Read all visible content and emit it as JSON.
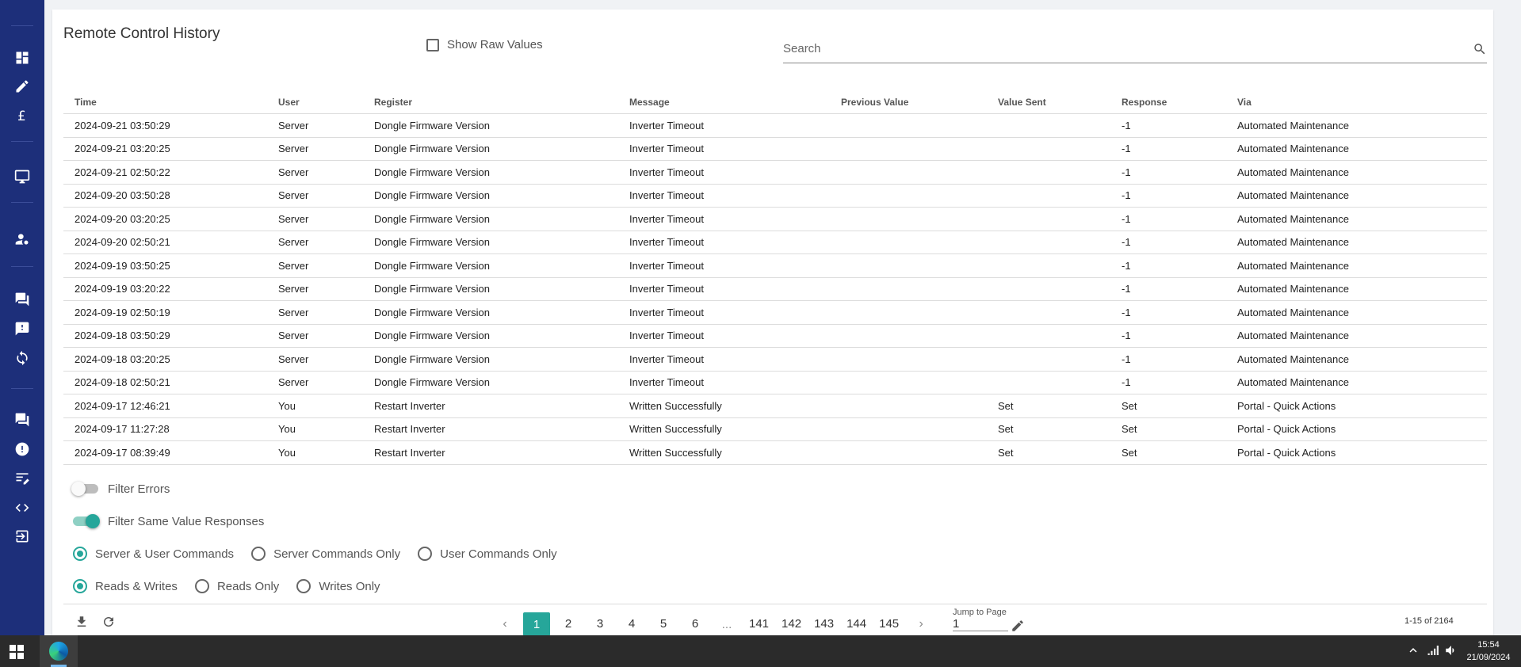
{
  "page": {
    "title": "Remote Control History"
  },
  "toolbar": {
    "show_raw_label": "Show Raw Values",
    "search_placeholder": "Search"
  },
  "table": {
    "columns": [
      "Time",
      "User",
      "Register",
      "Message",
      "Previous Value",
      "Value Sent",
      "Response",
      "Via"
    ],
    "rows": [
      [
        "2024-09-21 03:50:29",
        "Server",
        "Dongle Firmware Version",
        "Inverter Timeout",
        "",
        "",
        "-1",
        "Automated Maintenance"
      ],
      [
        "2024-09-21 03:20:25",
        "Server",
        "Dongle Firmware Version",
        "Inverter Timeout",
        "",
        "",
        "-1",
        "Automated Maintenance"
      ],
      [
        "2024-09-21 02:50:22",
        "Server",
        "Dongle Firmware Version",
        "Inverter Timeout",
        "",
        "",
        "-1",
        "Automated Maintenance"
      ],
      [
        "2024-09-20 03:50:28",
        "Server",
        "Dongle Firmware Version",
        "Inverter Timeout",
        "",
        "",
        "-1",
        "Automated Maintenance"
      ],
      [
        "2024-09-20 03:20:25",
        "Server",
        "Dongle Firmware Version",
        "Inverter Timeout",
        "",
        "",
        "-1",
        "Automated Maintenance"
      ],
      [
        "2024-09-20 02:50:21",
        "Server",
        "Dongle Firmware Version",
        "Inverter Timeout",
        "",
        "",
        "-1",
        "Automated Maintenance"
      ],
      [
        "2024-09-19 03:50:25",
        "Server",
        "Dongle Firmware Version",
        "Inverter Timeout",
        "",
        "",
        "-1",
        "Automated Maintenance"
      ],
      [
        "2024-09-19 03:20:22",
        "Server",
        "Dongle Firmware Version",
        "Inverter Timeout",
        "",
        "",
        "-1",
        "Automated Maintenance"
      ],
      [
        "2024-09-19 02:50:19",
        "Server",
        "Dongle Firmware Version",
        "Inverter Timeout",
        "",
        "",
        "-1",
        "Automated Maintenance"
      ],
      [
        "2024-09-18 03:50:29",
        "Server",
        "Dongle Firmware Version",
        "Inverter Timeout",
        "",
        "",
        "-1",
        "Automated Maintenance"
      ],
      [
        "2024-09-18 03:20:25",
        "Server",
        "Dongle Firmware Version",
        "Inverter Timeout",
        "",
        "",
        "-1",
        "Automated Maintenance"
      ],
      [
        "2024-09-18 02:50:21",
        "Server",
        "Dongle Firmware Version",
        "Inverter Timeout",
        "",
        "",
        "-1",
        "Automated Maintenance"
      ],
      [
        "2024-09-17 12:46:21",
        "You",
        "Restart Inverter",
        "Written Successfully",
        "",
        "Set",
        "Set",
        "Portal - Quick Actions"
      ],
      [
        "2024-09-17 11:27:28",
        "You",
        "Restart Inverter",
        "Written Successfully",
        "",
        "Set",
        "Set",
        "Portal - Quick Actions"
      ],
      [
        "2024-09-17 08:39:49",
        "You",
        "Restart Inverter",
        "Written Successfully",
        "",
        "Set",
        "Set",
        "Portal - Quick Actions"
      ]
    ]
  },
  "filters": {
    "filter_errors": {
      "label": "Filter Errors",
      "on": false
    },
    "filter_same_value": {
      "label": "Filter Same Value Responses",
      "on": true
    },
    "command_scope": {
      "options": [
        "Server & User Commands",
        "Server Commands Only",
        "User Commands Only"
      ],
      "selected": "Server & User Commands"
    },
    "access_scope": {
      "options": [
        "Reads & Writes",
        "Reads Only",
        "Writes Only"
      ],
      "selected": "Reads & Writes"
    }
  },
  "pagination": {
    "prev": "‹",
    "next": "›",
    "pages_start": [
      "1",
      "2",
      "3",
      "4",
      "5",
      "6"
    ],
    "ellipsis": "...",
    "pages_end": [
      "141",
      "142",
      "143",
      "144",
      "145"
    ],
    "current": "1",
    "jump_label": "Jump to Page",
    "jump_value": "1",
    "count_text": "1-15 of 2164"
  },
  "taskbar": {
    "time": "15:54",
    "date": "21/09/2024"
  },
  "colors": {
    "sidebar": "#1d2f7a",
    "accent": "#26a69a",
    "taskbar": "#2b2b2b"
  }
}
